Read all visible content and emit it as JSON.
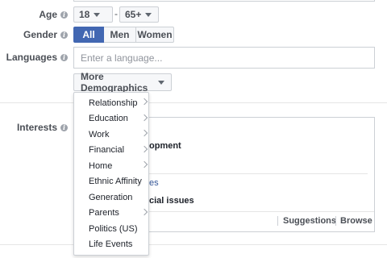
{
  "age": {
    "label": "Age",
    "min": "18",
    "separator": "-",
    "max": "65+"
  },
  "gender": {
    "label": "Gender",
    "options": [
      "All",
      "Men",
      "Women"
    ],
    "selected": "All"
  },
  "languages": {
    "label": "Languages",
    "placeholder": "Enter a language..."
  },
  "more_demographics": {
    "label": "More Demographics"
  },
  "interests": {
    "label": "Interests",
    "text_1": "opment",
    "text_2": "es",
    "text_3": "cial issues",
    "suggestions": "Suggestions",
    "browse": "Browse"
  },
  "menu": {
    "items": [
      {
        "label": "Relationship",
        "submenu": true
      },
      {
        "label": "Education",
        "submenu": true
      },
      {
        "label": "Work",
        "submenu": true
      },
      {
        "label": "Financial",
        "submenu": true
      },
      {
        "label": "Home",
        "submenu": true
      },
      {
        "label": "Ethnic Affinity",
        "submenu": false
      },
      {
        "label": "Generation",
        "submenu": false
      },
      {
        "label": "Parents",
        "submenu": true
      },
      {
        "label": "Politics (US)",
        "submenu": false
      },
      {
        "label": "Life Events",
        "submenu": false
      }
    ]
  },
  "colors": {
    "accent": "#4267b2",
    "link": "#365899"
  }
}
